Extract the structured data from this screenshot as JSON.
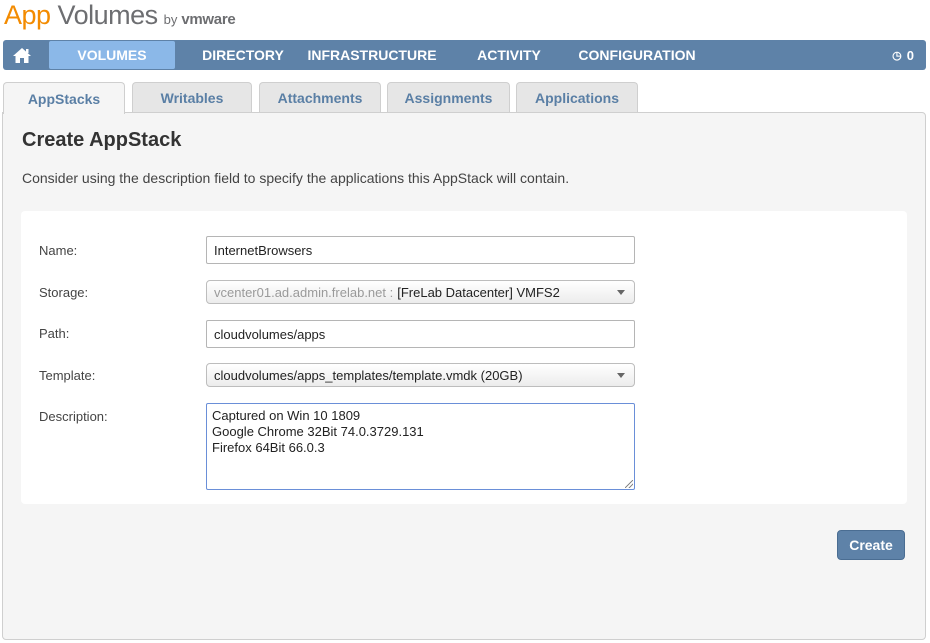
{
  "brand": {
    "app": "App",
    "volumes": "Volumes",
    "by": "by",
    "vmware": "vmware"
  },
  "nav": {
    "items": [
      {
        "label": "VOLUMES",
        "active": true
      },
      {
        "label": "DIRECTORY",
        "active": false
      },
      {
        "label": "INFRASTRUCTURE",
        "active": false
      },
      {
        "label": "ACTIVITY",
        "active": false
      },
      {
        "label": "CONFIGURATION",
        "active": false
      }
    ],
    "alerts_count": "0",
    "home_icon": "home-icon",
    "alerts_icon": "clock-icon"
  },
  "tabs": [
    {
      "label": "AppStacks",
      "active": true
    },
    {
      "label": "Writables",
      "active": false
    },
    {
      "label": "Attachments",
      "active": false
    },
    {
      "label": "Assignments",
      "active": false
    },
    {
      "label": "Applications",
      "active": false
    }
  ],
  "page": {
    "title": "Create AppStack",
    "description": "Consider using the description field to specify the applications this AppStack will contain."
  },
  "form": {
    "name_label": "Name:",
    "name_value": "InternetBrowsers",
    "storage_label": "Storage:",
    "storage_host": "vcenter01.ad.admin.frelab.net :",
    "storage_datastore": "[FreLab Datacenter] VMFS2",
    "path_label": "Path:",
    "path_value": "cloudvolumes/apps",
    "template_label": "Template:",
    "template_value": "cloudvolumes/apps_templates/template.vmdk (20GB)",
    "description_label": "Description:",
    "description_lines": [
      "Captured on Win 10 1809",
      "Google Chrome 32Bit 74.0.3729.131",
      "Firefox 64Bit 66.0.3"
    ]
  },
  "actions": {
    "create_label": "Create"
  },
  "colors": {
    "nav_bg": "#5e82a8",
    "nav_active": "#8bb8e8",
    "brand_orange": "#f38b00",
    "tab_text": "#5a7fa5"
  }
}
